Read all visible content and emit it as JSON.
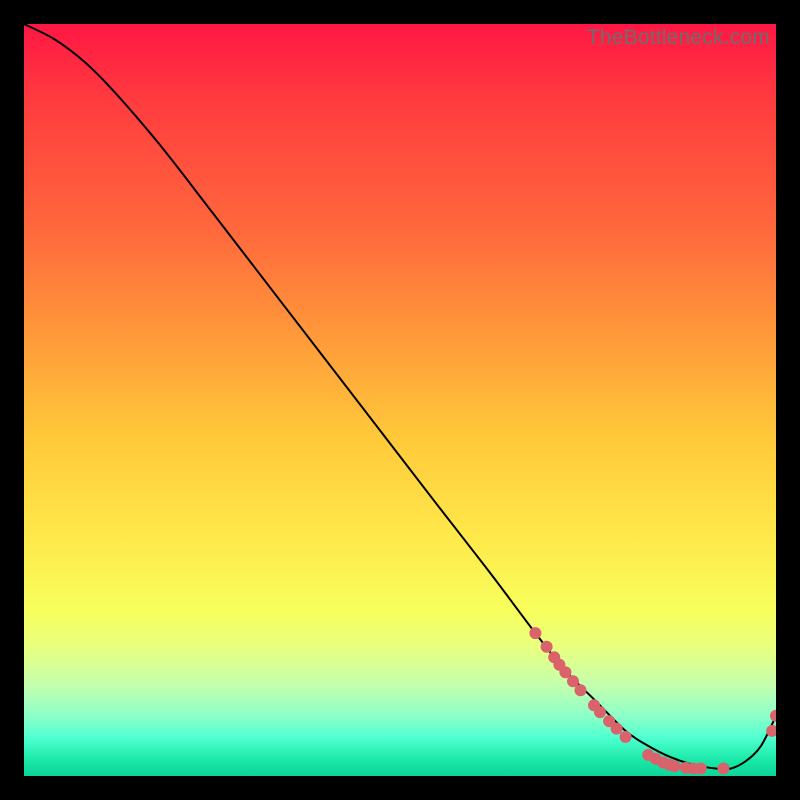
{
  "watermark": "TheBottleneck.com",
  "colors": {
    "page_bg": "#000000",
    "curve": "#000000",
    "marker": "#d9626b"
  },
  "chart_data": {
    "type": "line",
    "title": "",
    "xlabel": "",
    "ylabel": "",
    "xlim": [
      0,
      100
    ],
    "ylim": [
      0,
      100
    ],
    "grid": false,
    "legend": false,
    "series": [
      {
        "name": "curve",
        "x": [
          0,
          4,
          8,
          12,
          18,
          25,
          35,
          45,
          55,
          62,
          68,
          72,
          76,
          80,
          83,
          86,
          89,
          92,
          94,
          96,
          98,
          100
        ],
        "y": [
          100,
          98,
          95,
          91,
          84,
          75,
          62,
          49,
          36,
          27,
          19,
          14,
          10,
          6,
          4,
          2.5,
          1.5,
          1,
          1,
          2,
          4,
          8
        ]
      }
    ],
    "markers": [
      {
        "x": 68.0,
        "y": 19.0
      },
      {
        "x": 69.5,
        "y": 17.2
      },
      {
        "x": 70.5,
        "y": 15.8
      },
      {
        "x": 71.2,
        "y": 14.8
      },
      {
        "x": 72.0,
        "y": 13.8
      },
      {
        "x": 73.0,
        "y": 12.6
      },
      {
        "x": 74.0,
        "y": 11.4
      },
      {
        "x": 75.8,
        "y": 9.4
      },
      {
        "x": 76.6,
        "y": 8.5
      },
      {
        "x": 77.8,
        "y": 7.3
      },
      {
        "x": 78.8,
        "y": 6.3
      },
      {
        "x": 80.0,
        "y": 5.2
      },
      {
        "x": 83.0,
        "y": 2.8
      },
      {
        "x": 84.0,
        "y": 2.3
      },
      {
        "x": 85.0,
        "y": 1.8
      },
      {
        "x": 85.8,
        "y": 1.5
      },
      {
        "x": 86.5,
        "y": 1.3
      },
      {
        "x": 88.0,
        "y": 1.1
      },
      {
        "x": 89.0,
        "y": 1.0
      },
      {
        "x": 90.0,
        "y": 1.0
      },
      {
        "x": 93.0,
        "y": 1.0
      },
      {
        "x": 99.5,
        "y": 6.0
      },
      {
        "x": 100.0,
        "y": 8.0
      }
    ]
  }
}
